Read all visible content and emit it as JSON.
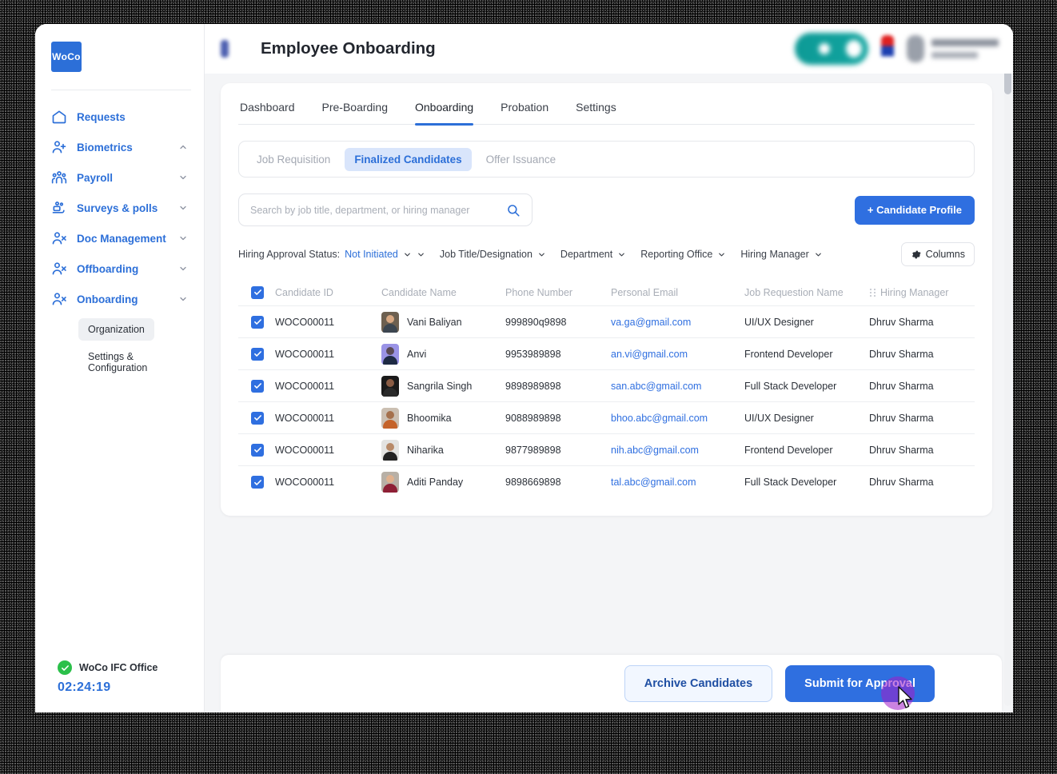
{
  "app": {
    "logo_text": "WoCo",
    "page_title": "Employee Onboarding"
  },
  "sidebar": {
    "items": [
      {
        "label": "Requests",
        "icon": "home-icon",
        "chevron": "none"
      },
      {
        "label": "Biometrics",
        "icon": "user-plus-icon",
        "chevron": "up"
      },
      {
        "label": "Payroll",
        "icon": "people-group-icon",
        "chevron": "down"
      },
      {
        "label": "Surveys & polls",
        "icon": "survey-hand-icon",
        "chevron": "down"
      },
      {
        "label": "Doc Management",
        "icon": "user-x-icon",
        "chevron": "down"
      },
      {
        "label": "Offboarding",
        "icon": "user-x-icon",
        "chevron": "down"
      },
      {
        "label": "Onboarding",
        "icon": "user-x-icon",
        "chevron": "down"
      }
    ],
    "subitems": [
      {
        "label": "Organization",
        "active": true
      },
      {
        "label": "Settings & Configuration",
        "active": false
      }
    ],
    "footer": {
      "office_name": "WoCo IFC Office",
      "timer": "02:24:19",
      "status_icon": "check-circle-icon",
      "status_color": "#2bc04a"
    }
  },
  "tabs": [
    {
      "label": "Dashboard",
      "active": false
    },
    {
      "label": "Pre-Boarding",
      "active": false
    },
    {
      "label": "Onboarding",
      "active": true
    },
    {
      "label": "Probation",
      "active": false
    },
    {
      "label": "Settings",
      "active": false
    }
  ],
  "segmented": [
    {
      "label": "Job Requisition",
      "active": false
    },
    {
      "label": "Finalized Candidates",
      "active": true
    },
    {
      "label": "Offer Issuance",
      "active": false
    }
  ],
  "search": {
    "placeholder": "Search by job title, department, or hiring manager",
    "value": "",
    "icon": "search-icon"
  },
  "actions": {
    "add_candidate_label": "+ Candidate Profile",
    "columns_label": "Columns",
    "archive_label": "Archive Candidates",
    "submit_label": "Submit for Approval"
  },
  "filters": {
    "status_prefix": "Hiring Approval Status:",
    "status_value": "Not Initiated",
    "items": [
      {
        "label": "Job Title/Designation"
      },
      {
        "label": "Department"
      },
      {
        "label": "Reporting Office"
      },
      {
        "label": "Hiring Manager"
      }
    ]
  },
  "table": {
    "columns": [
      "Candidate ID",
      "Candidate Name",
      "Phone Number",
      "Personal Email",
      "Job Requestion Name",
      "Hiring Manager"
    ],
    "select_all_checked": true,
    "rows": [
      {
        "checked": true,
        "id": "WOCO00011",
        "name": "Vani Baliyan",
        "phone": "999890q9898",
        "email": "va.ga@gmail.com",
        "job": "UI/UX Designer",
        "manager": "Dhruv Sharma",
        "avatar_bg": "#6d6050",
        "avatar_skin": "#d8a882",
        "avatar_cloth": "#3c4650"
      },
      {
        "checked": true,
        "id": "WOCO00011",
        "name": "Anvi",
        "phone": "9953989898",
        "email": "an.vi@gmail.com",
        "job": "Frontend Developer",
        "manager": "Dhruv Sharma",
        "avatar_bg": "#9a93e6",
        "avatar_skin": "#5a4a56",
        "avatar_cloth": "#1e2a44"
      },
      {
        "checked": true,
        "id": "WOCO00011",
        "name": "Sangrila Singh",
        "phone": "9898989898",
        "email": "san.abc@gmail.com",
        "job": "Full Stack Developer",
        "manager": "Dhruv Sharma",
        "avatar_bg": "#1a1a1a",
        "avatar_skin": "#8a5c44",
        "avatar_cloth": "#2a2a2a"
      },
      {
        "checked": true,
        "id": "WOCO00011",
        "name": "Bhoomika",
        "phone": "9088989898",
        "email": "bhoo.abc@gmail.com",
        "job": "UI/UX Designer",
        "manager": "Dhruv Sharma",
        "avatar_bg": "#cbbfb2",
        "avatar_skin": "#a5704c",
        "avatar_cloth": "#c5632a"
      },
      {
        "checked": true,
        "id": "WOCO00011",
        "name": "Niharika",
        "phone": "9877989898",
        "email": "nih.abc@gmail.com",
        "job": "Frontend Developer",
        "manager": "Dhruv Sharma",
        "avatar_bg": "#e3e3e1",
        "avatar_skin": "#b88a68",
        "avatar_cloth": "#232323"
      },
      {
        "checked": true,
        "id": "WOCO00011",
        "name": "Aditi Panday",
        "phone": "9898669898",
        "email": "tal.abc@gmail.com",
        "job": "Full Stack Developer",
        "manager": "Dhruv Sharma",
        "avatar_bg": "#b8b0a6",
        "avatar_skin": "#e0b18e",
        "avatar_cloth": "#8e1f35"
      }
    ]
  },
  "colors": {
    "accent_blue": "#2f6fe0",
    "nav_blue": "#2c6fd8",
    "segment_active_bg": "#d9e5fb",
    "status_green": "#2bc04a",
    "cursor_ripple": "#a01ec8"
  }
}
